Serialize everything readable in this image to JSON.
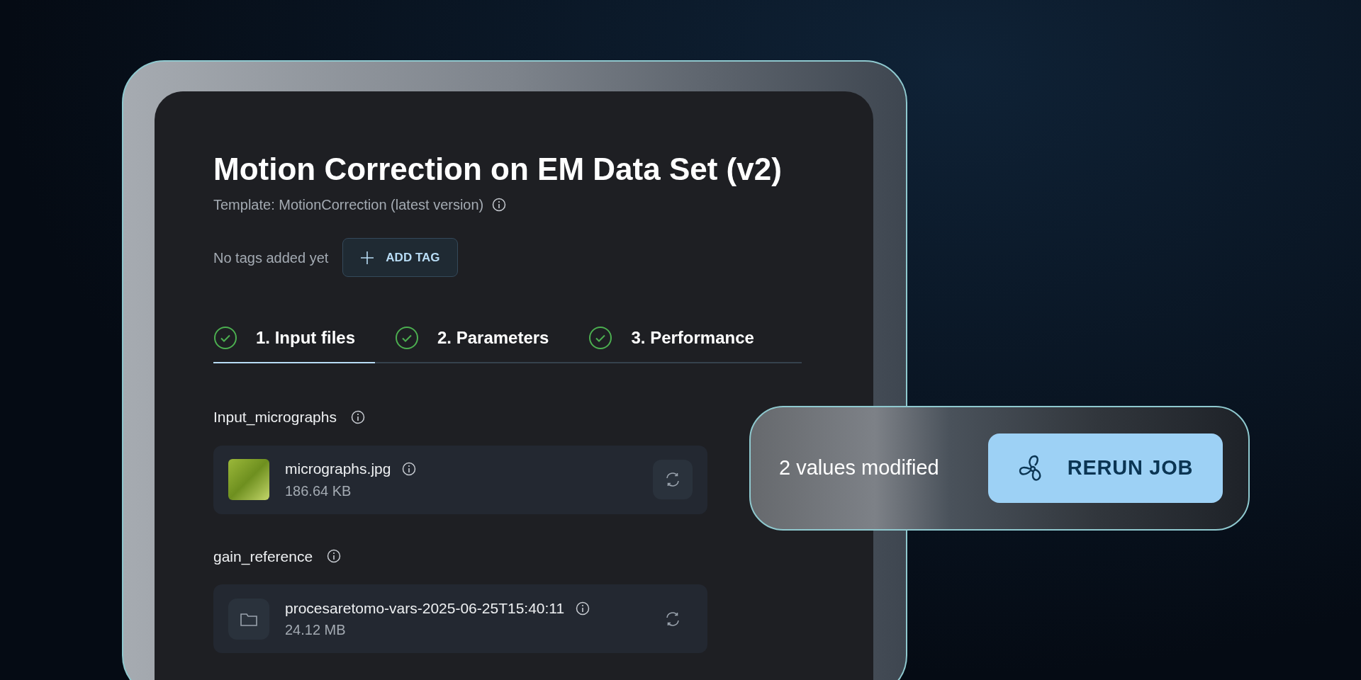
{
  "job": {
    "title": "Motion Correction on EM Data Set (v2)",
    "template": "Template: MotionCorrection (latest version)"
  },
  "tags": {
    "empty_text": "No tags added yet",
    "add_button": "ADD TAG"
  },
  "tabs": [
    {
      "label": "1. Input files",
      "completed": true,
      "selected": true
    },
    {
      "label": "2. Parameters",
      "completed": true,
      "selected": false
    },
    {
      "label": "3. Performance",
      "completed": true,
      "selected": false
    }
  ],
  "inputs": [
    {
      "label": "Input_micrographs",
      "file": {
        "kind": "image",
        "name": "micrographs.jpg",
        "size": "186.64 KB"
      }
    },
    {
      "label": "gain_reference",
      "file": {
        "kind": "folder",
        "name": "procesaretomo-vars-2025-06-25T15:40:11",
        "size": "24.12 MB"
      }
    }
  ],
  "changes_bar": {
    "text": "2 values modified",
    "button": "RERUN JOB"
  }
}
